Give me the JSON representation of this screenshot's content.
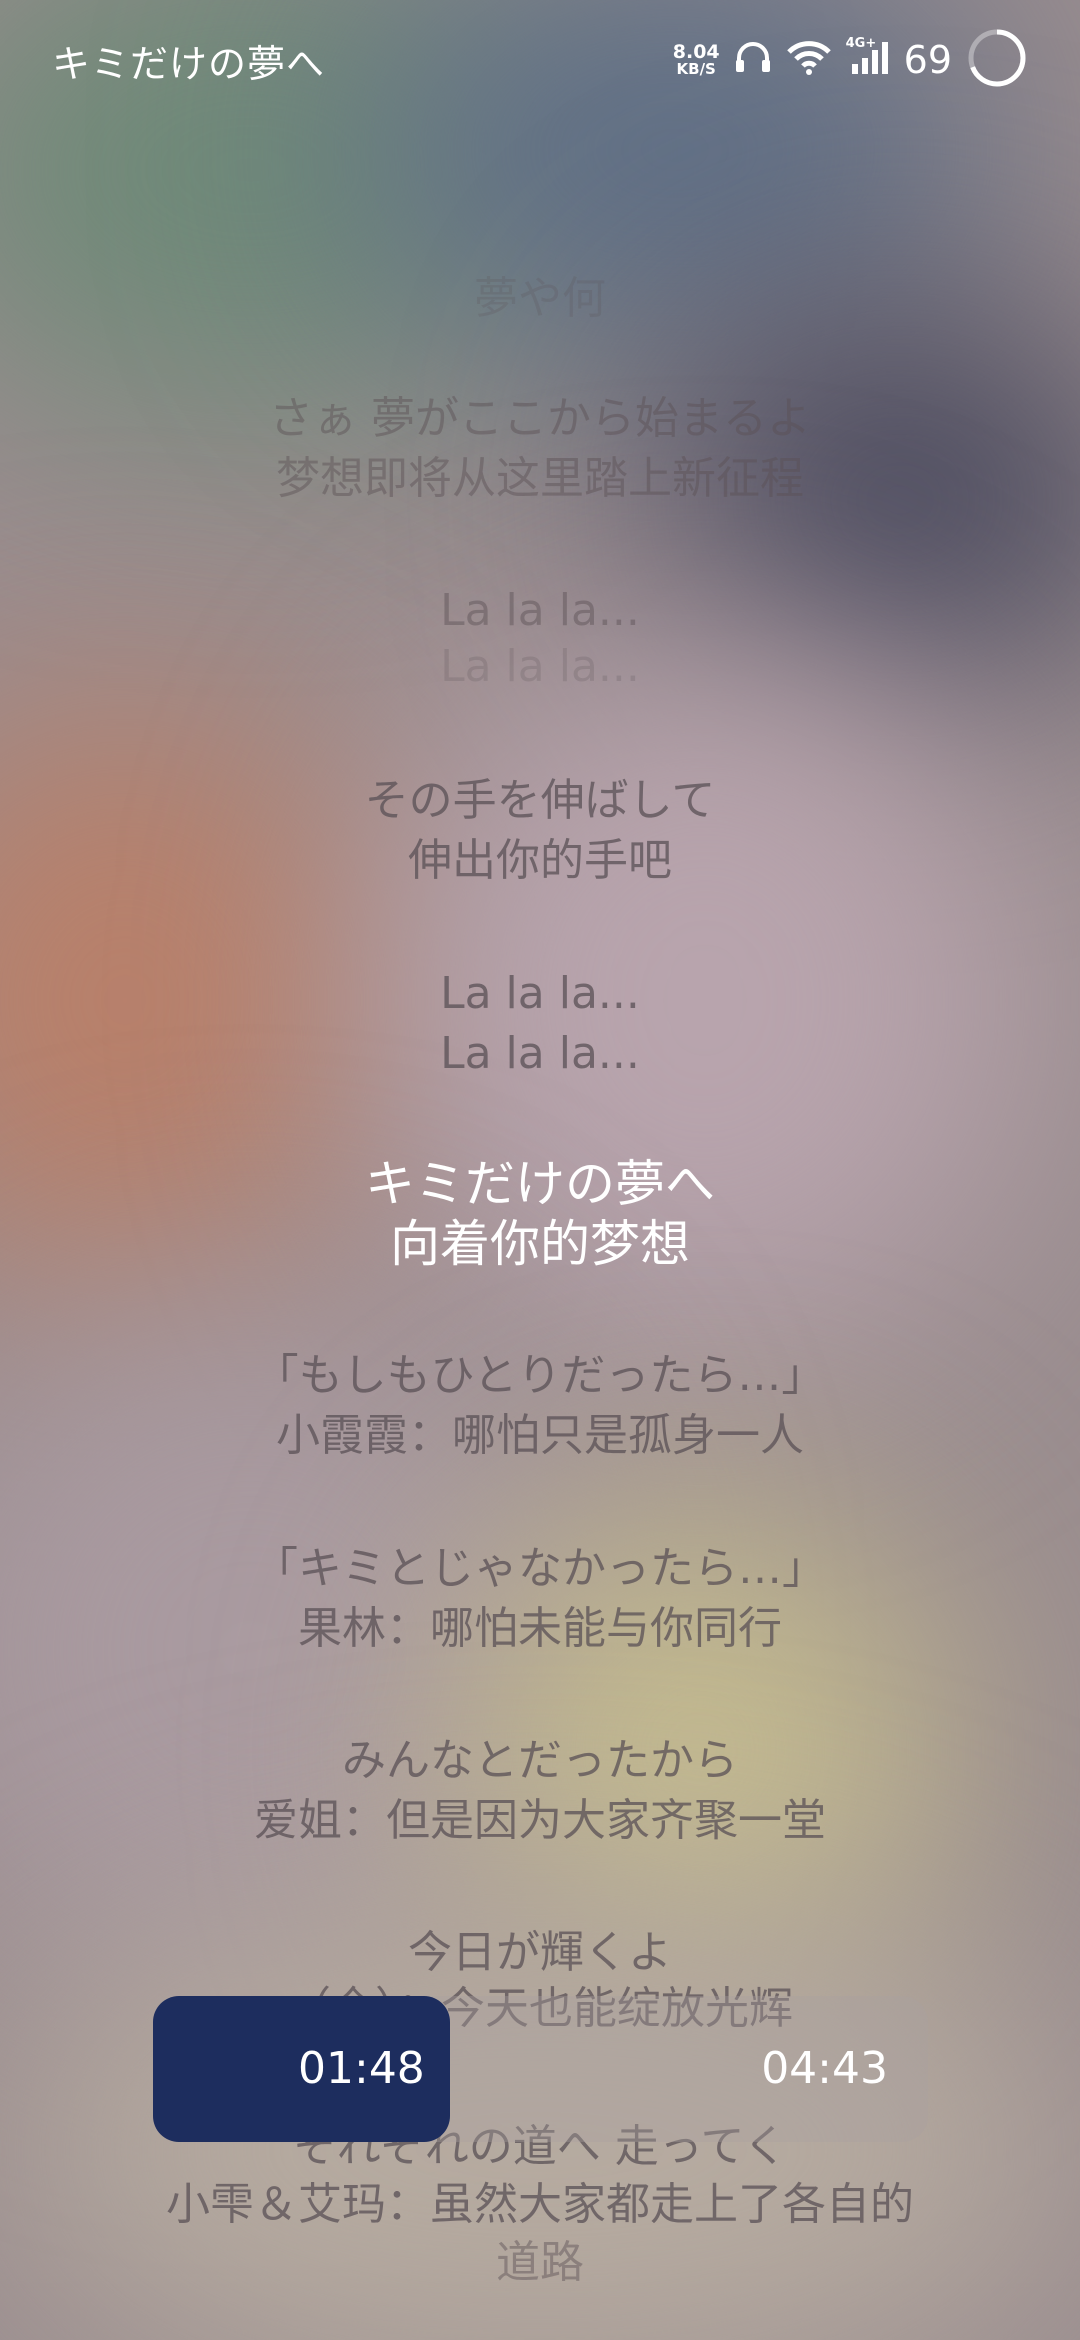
{
  "status_bar": {
    "song_title": "キミだけの夢へ",
    "net_speed_value": "8.04",
    "net_speed_unit": "KB/S",
    "network_type": "4G+",
    "battery": "69",
    "icons": [
      "headphones-icon",
      "wifi-icon",
      "signal-icon",
      "battery-ring-icon"
    ]
  },
  "lyrics": [
    {
      "jp": "夢や何",
      "cn": ""
    },
    {
      "jp": "さぁ 夢がここから始まるよ",
      "cn": "梦想即将从这里踏上新征程"
    },
    {
      "jp": "La la la...",
      "cn": "La la la..."
    },
    {
      "jp": "その手を伸ばして",
      "cn": "伸出你的手吧"
    },
    {
      "jp": "La la la...",
      "cn": "La la la..."
    },
    {
      "jp": "キミだけの夢へ",
      "cn": "向着你的梦想"
    },
    {
      "jp": "「もしもひとりだったら…」",
      "cn": "小霞霞：哪怕只是孤身一人"
    },
    {
      "jp": "「キミとじゃなかったら…」",
      "cn": "果林：哪怕未能与你同行"
    },
    {
      "jp": "みんなとだったから",
      "cn": "爱姐：但是因为大家齐聚一堂"
    },
    {
      "jp": "今日が輝くよ",
      "cn": "（全）：今天也能绽放光辉"
    },
    {
      "jp": "それぞれの道へ 走ってく",
      "cn": "小雫＆艾玛：虽然大家都走上了各自的",
      "cn2": "道路"
    }
  ],
  "player": {
    "elapsed": "01:48",
    "total": "04:43",
    "progress_fraction": 0.383,
    "fill_color": "#1d2d5e"
  }
}
